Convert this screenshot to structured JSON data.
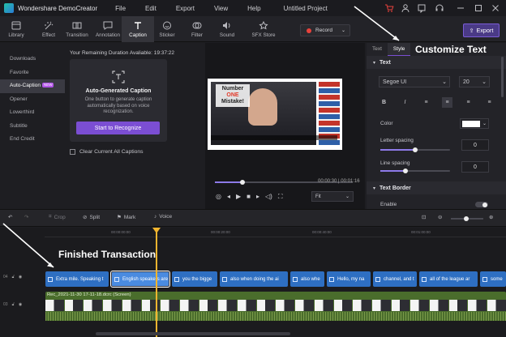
{
  "titlebar": {
    "app_name": "Wondershare DemoCreator",
    "menus": [
      "File",
      "Edit",
      "Export",
      "View",
      "Help"
    ],
    "project_title": "Untitled Project"
  },
  "toolbar": {
    "tools": [
      {
        "label": "Library",
        "icon": "library-icon"
      },
      {
        "label": "Effect",
        "icon": "effect-icon"
      },
      {
        "label": "Transition",
        "icon": "transition-icon"
      },
      {
        "label": "Annotation",
        "icon": "annotation-icon"
      },
      {
        "label": "Caption",
        "icon": "caption-icon",
        "active": true
      },
      {
        "label": "Sticker",
        "icon": "sticker-icon"
      },
      {
        "label": "Filter",
        "icon": "filter-icon"
      },
      {
        "label": "Sound",
        "icon": "sound-icon"
      },
      {
        "label": "SFX Store",
        "icon": "sfx-store-icon"
      }
    ],
    "record_label": "Record",
    "export_label": "Export"
  },
  "left_nav": {
    "items": [
      {
        "label": "Downloads"
      },
      {
        "label": "Favorite"
      },
      {
        "label": "Auto-Caption",
        "badge": "NEW",
        "active": true
      },
      {
        "label": "Opener"
      },
      {
        "label": "Lowerthird"
      },
      {
        "label": "Subtitle"
      },
      {
        "label": "End Credit"
      }
    ]
  },
  "caption_panel": {
    "duration_text": "Your Remaining Duration Avaliable: 19:37:22",
    "card_title": "Auto-Generated Caption",
    "card_desc": "One button to generate caption automatically based on voice recognization.",
    "button_label": "Start to Recognize",
    "clear_label": "Clear Current All Captions"
  },
  "preview": {
    "overlay_line1": "Number",
    "overlay_line2": "ONE",
    "overlay_line3": "Mistake!",
    "time_current": "00:00:30",
    "time_total": "00:01:16",
    "progress": 0.5,
    "zoom_option": "Fit"
  },
  "right_panel": {
    "tabs": [
      "Text",
      "Style"
    ],
    "active_tab": "Style",
    "annotation": "Customize Text",
    "text_section": "Text",
    "font_family": "Segoe UI",
    "font_size": "20",
    "color_label": "Color",
    "color_value": "#ffffff",
    "letter_spacing_label": "Letter spacing",
    "letter_spacing_value": "0",
    "line_spacing_label": "Line spacing",
    "line_spacing_value": "0",
    "border_section": "Text Border",
    "enable_label": "Enable"
  },
  "timeline_toolbar": {
    "crop_label": "Crop",
    "split_label": "Split",
    "mark_label": "Mark",
    "voice_label": "Voice"
  },
  "timeline": {
    "ruler_ticks": [
      "00:00:00:00",
      "00:00:20:00",
      "00:00:40:00",
      "00:01:00:00",
      "00:01:20:00"
    ],
    "annotation": "Finished Transaction",
    "track_numbers": [
      "04",
      "03"
    ],
    "caption_clips": [
      "Extra mile. Speaking t",
      "English speakers are",
      "you the bigge",
      "also when doing the ai",
      "also whe",
      "Hello, my na",
      "channel, and t",
      "all of the league ar",
      "some"
    ],
    "video_clip_label": "Rec_2021-11-30 17-11-18.dcrc (Screen)"
  }
}
